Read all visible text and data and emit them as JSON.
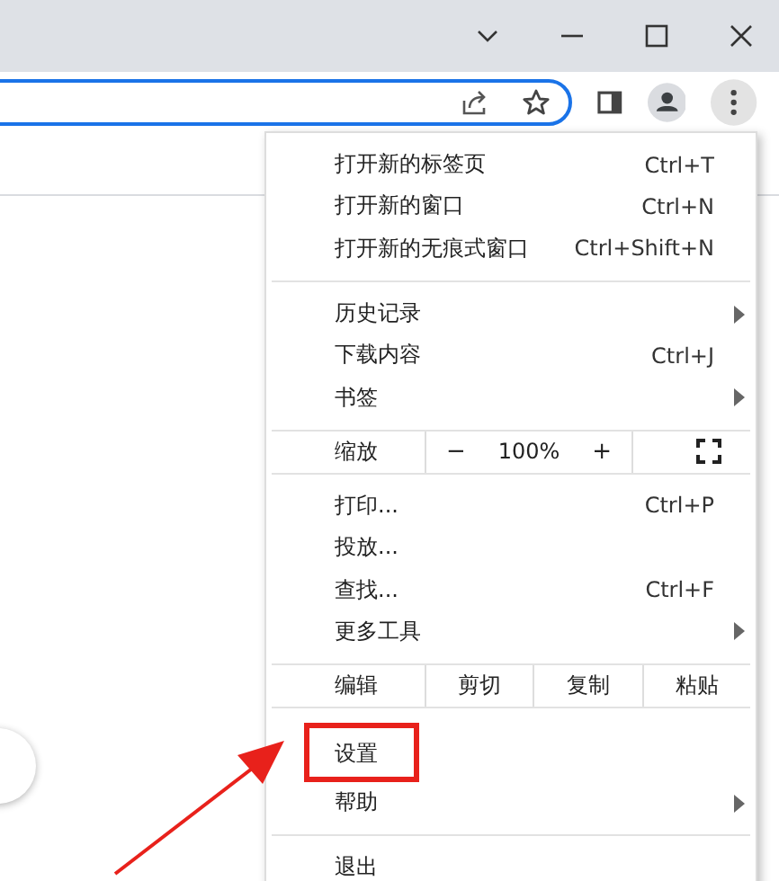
{
  "menu": {
    "sections": [
      {
        "kind": "items",
        "items": [
          {
            "label": "打开新的标签页",
            "shortcut": "Ctrl+T",
            "submenu": false,
            "highlighted": false
          },
          {
            "label": "打开新的窗口",
            "shortcut": "Ctrl+N",
            "submenu": false,
            "highlighted": false
          },
          {
            "label": "打开新的无痕式窗口",
            "shortcut": "Ctrl+Shift+N",
            "submenu": false,
            "highlighted": false
          }
        ]
      },
      {
        "kind": "items",
        "items": [
          {
            "label": "历史记录",
            "submenu": true,
            "highlighted": false
          },
          {
            "label": "下载内容",
            "shortcut": "Ctrl+J",
            "submenu": false,
            "highlighted": false
          },
          {
            "label": "书签",
            "submenu": true,
            "highlighted": false
          }
        ]
      },
      {
        "kind": "zoom",
        "label": "缩放",
        "minus": "−",
        "value": "100%",
        "plus": "+"
      },
      {
        "kind": "items",
        "items": [
          {
            "label": "打印...",
            "shortcut": "Ctrl+P",
            "submenu": false,
            "highlighted": false
          },
          {
            "label": "投放...",
            "submenu": false,
            "highlighted": false
          },
          {
            "label": "查找...",
            "shortcut": "Ctrl+F",
            "submenu": false,
            "highlighted": false
          },
          {
            "label": "更多工具",
            "submenu": true,
            "highlighted": false
          }
        ]
      },
      {
        "kind": "edit",
        "label": "编辑",
        "actions": [
          "剪切",
          "复制",
          "粘贴"
        ]
      },
      {
        "kind": "items",
        "items": [
          {
            "label": "设置",
            "submenu": false,
            "highlighted": true
          },
          {
            "label": "帮助",
            "submenu": true,
            "highlighted": false
          }
        ]
      },
      {
        "kind": "items",
        "items": [
          {
            "label": "退出",
            "submenu": false,
            "highlighted": false
          }
        ]
      }
    ]
  }
}
